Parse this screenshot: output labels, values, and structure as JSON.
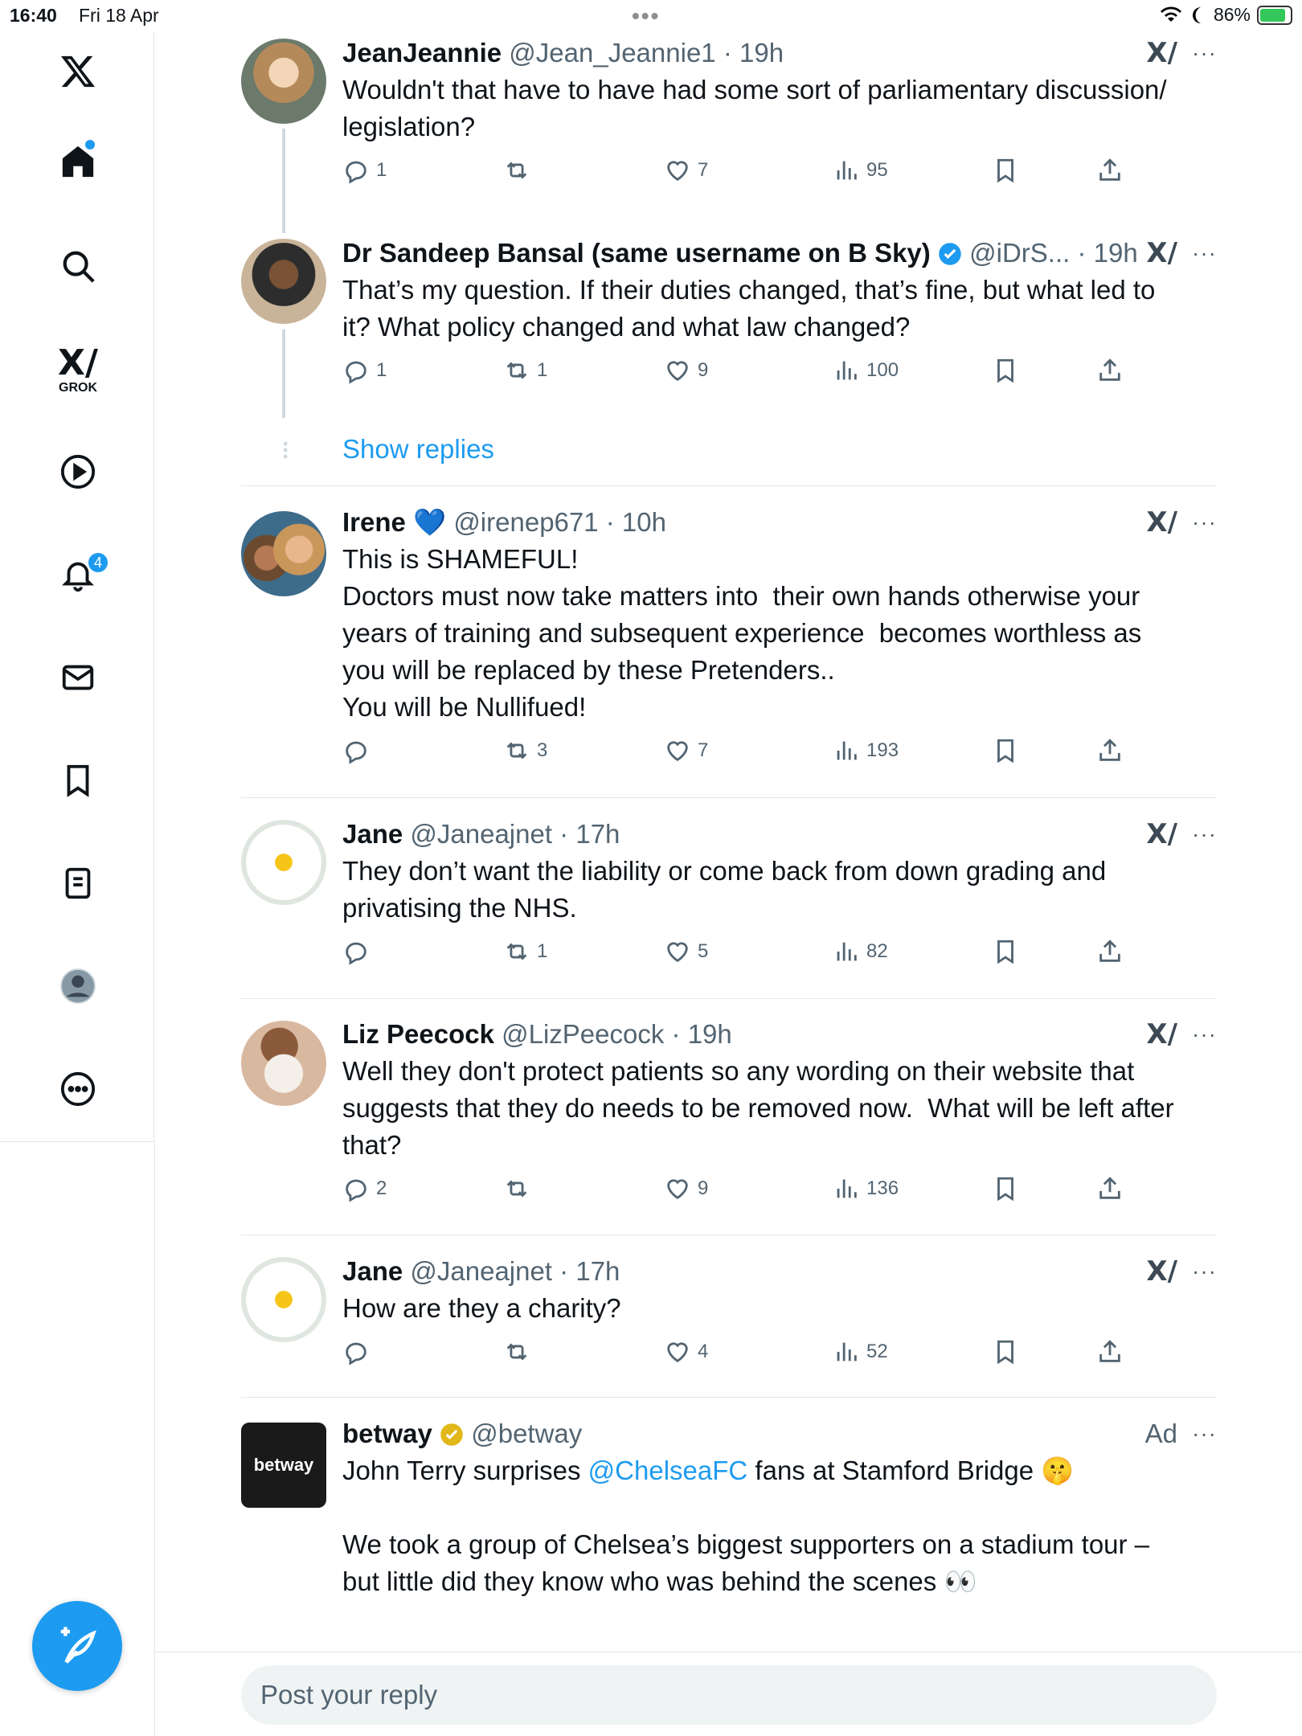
{
  "status": {
    "time": "16:40",
    "date": "Fri 18 Apr",
    "battery": "86%"
  },
  "sidebar": {
    "grok_label": "GROK",
    "notifications_count": "4"
  },
  "tweets": [
    {
      "name": "JeanJeannie",
      "meta": "@Jean_Jeannie1 · 19h",
      "text": "Wouldn't that have to have had some sort of parliamentary discussion/\nlegislation?",
      "replies": "1",
      "reposts": "",
      "likes": "7",
      "views": "95"
    },
    {
      "name": "Dr Sandeep Bansal (same username on B Sky)",
      "meta": "@iDrS... · 19h",
      "text": "That’s my question. If their duties changed, that’s fine, but what led to\nit? What policy changed and what law changed?",
      "replies": "1",
      "reposts": "1",
      "likes": "9",
      "views": "100"
    },
    {
      "name": "Irene 💙",
      "meta": "@irenep671 · 10h",
      "text": "This is SHAMEFUL!\nDoctors must now take matters into  their own hands otherwise your\nyears of training and subsequent experience  becomes worthless as\nyou will be replaced by these Pretenders..\nYou will be Nullifued!",
      "replies": "",
      "reposts": "3",
      "likes": "7",
      "views": "193"
    },
    {
      "name": "Jane",
      "meta": "@Janeajnet · 17h",
      "text": "They don’t want the liability or come back from down grading and\nprivatising the NHS.",
      "replies": "",
      "reposts": "1",
      "likes": "5",
      "views": "82"
    },
    {
      "name": "Liz Peecock",
      "meta": "@LizPeecock · 19h",
      "text": "Well they don't protect patients so any wording on their website that\nsuggests that they do needs to be removed now.  What will be left after\nthat?",
      "replies": "2",
      "reposts": "",
      "likes": "9",
      "views": "136"
    },
    {
      "name": "Jane",
      "meta": "@Janeajnet · 17h",
      "text": "How are they a charity?",
      "replies": "",
      "reposts": "",
      "likes": "4",
      "views": "52"
    }
  ],
  "show_replies": "Show replies",
  "ad": {
    "name": "betway",
    "handle": "@betway",
    "ad_label": "Ad",
    "avatar_text": "betway",
    "text_before": "John Terry surprises ",
    "mention": "@ChelseaFC",
    "text_after": " fans at Stamford Bridge 🤫",
    "text2": "We took a group of Chelsea’s biggest supporters on a stadium tour –\nbut little did they know who was behind the scenes 👀"
  },
  "reply_placeholder": "Post your reply",
  "colors": {
    "accent": "#1d9bf0",
    "text": "#0f1419",
    "muted": "#536471"
  }
}
